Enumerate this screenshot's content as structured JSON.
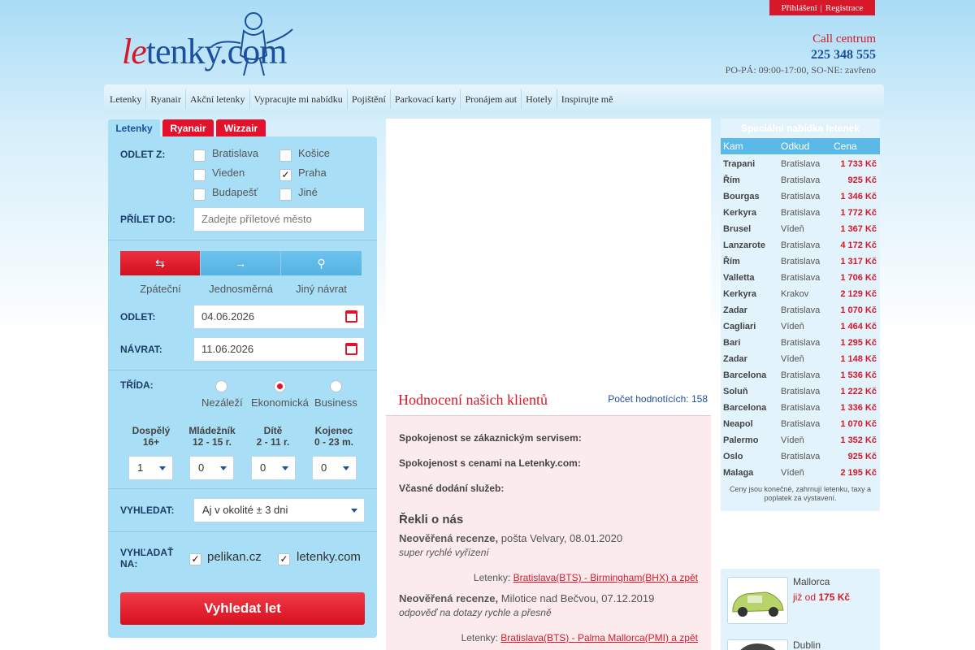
{
  "header": {
    "login": "Přihlášení",
    "divider": "|",
    "register": "Registrace",
    "logo_text_le": "le",
    "logo_text_rest": "tenky.com",
    "call_label": "Call centrum",
    "call_number": "225 348 555",
    "call_hours": "PO-PÁ: 09:00-17:00, SO-NE: zavřeno"
  },
  "nav": [
    "Letenky",
    "Ryanair",
    "Akční letenky",
    "Vypracujte mi nabídku",
    "Pojištění",
    "Parkovací karty",
    "Pronájem aut",
    "Hotely",
    "Inspirujte mě"
  ],
  "search": {
    "tabs": [
      "Letenky",
      "Ryanair",
      "Wizzair"
    ],
    "from_label": "ODLET Z:",
    "origins": [
      {
        "label": "Bratislava",
        "checked": false
      },
      {
        "label": "Košice",
        "checked": false
      },
      {
        "label": "Vieden",
        "checked": false
      },
      {
        "label": "Praha",
        "checked": true
      },
      {
        "label": "Budapešť",
        "checked": false
      },
      {
        "label": "Jiné",
        "checked": false
      }
    ],
    "to_label": "PŘÍLET DO:",
    "to_placeholder": "Zadejte příletové město",
    "trip_types": [
      "Zpáteční",
      "Jednosměrná",
      "Jiný návrat"
    ],
    "depart_label": "ODLET:",
    "depart_value": "04.06.2026",
    "return_label": "NÁVRAT:",
    "return_value": "11.06.2026",
    "class_label": "TŘÍDA:",
    "classes": [
      "Nezáleží",
      "Ekonomická",
      "Business"
    ],
    "class_selected": "Ekonomická",
    "pax": [
      {
        "title": "Dospělý",
        "sub": "16+",
        "value": "1"
      },
      {
        "title": "Mládežník",
        "sub": "12 - 15 r.",
        "value": "0"
      },
      {
        "title": "Dítě",
        "sub": "2 - 11 r.",
        "value": "0"
      },
      {
        "title": "Kojenec",
        "sub": "0 - 23 m.",
        "value": "0"
      }
    ],
    "flex_label": "VYHLEDAT:",
    "flex_value": "Aj v okolité ± 3 dni",
    "search_on_label_1": "VYHĽADAŤ",
    "search_on_label_2": "NA:",
    "search_on": [
      "pelikan.cz",
      "letenky.com"
    ],
    "submit": "Vyhledat let"
  },
  "reviews": {
    "title": "Hodnocení našich klientů",
    "count_label": "Počet hodnotících: 158",
    "criteria": [
      "Spokojenost se zákaznickým servisem:",
      "Spokojenost s cenami na Letenky.com:",
      "Včasné dodání služeb:"
    ],
    "said_title": "Řekli o nás",
    "items": [
      {
        "author": "Neověřená recenze,",
        "meta": " pošta Velvary, 08.01.2020",
        "text": "super rychlé vyřízení",
        "route_label": "Letenky: ",
        "route": "Bratislava(BTS) - Birmingham(BHX) a zpět"
      },
      {
        "author": "Neověřená recenze,",
        "meta": " Milotice nad Bečvou, 07.12.2019",
        "text": "odpověď na dotazy rychle a přesně",
        "route_label": "Letenky: ",
        "route": "Bratislava(BTS) - Palma Mallorca(PMI) a zpět"
      }
    ]
  },
  "offers": {
    "title": "Speciální nabídka letenek",
    "columns": [
      "Kam",
      "Odkud",
      "Cena"
    ],
    "rows": [
      [
        "Trapani",
        "Bratislava",
        "1 733 Kč"
      ],
      [
        "Řím",
        "Bratislava",
        "925 Kč"
      ],
      [
        "Bourgas",
        "Bratislava",
        "1 346 Kč"
      ],
      [
        "Kerkyra",
        "Bratislava",
        "1 772 Kč"
      ],
      [
        "Brusel",
        "Vídeň",
        "1 367 Kč"
      ],
      [
        "Lanzarote",
        "Bratislava",
        "4 172 Kč"
      ],
      [
        "Řím",
        "Bratislava",
        "1 317 Kč"
      ],
      [
        "Valletta",
        "Bratislava",
        "1 706 Kč"
      ],
      [
        "Kerkyra",
        "Krakov",
        "2 129 Kč"
      ],
      [
        "Zadar",
        "Bratislava",
        "1 070 Kč"
      ],
      [
        "Cagliari",
        "Vídeň",
        "1 464 Kč"
      ],
      [
        "Bari",
        "Bratislava",
        "1 295 Kč"
      ],
      [
        "Zadar",
        "Vídeň",
        "1 148 Kč"
      ],
      [
        "Barcelona",
        "Bratislava",
        "1 536 Kč"
      ],
      [
        "Soluň",
        "Bratislava",
        "1 222 Kč"
      ],
      [
        "Barcelona",
        "Bratislava",
        "1 336 Kč"
      ],
      [
        "Neapol",
        "Bratislava",
        "1 070 Kč"
      ],
      [
        "Palermo",
        "Vídeň",
        "1 352 Kč"
      ],
      [
        "Oslo",
        "Bratislava",
        "925 Kč"
      ],
      [
        "Malaga",
        "Vídeň",
        "2 195 Kč"
      ]
    ],
    "note": "Ceny jsou konečné, zahrnují letenku, taxy a poplatek za vystavení."
  },
  "cars": [
    {
      "city": "Mallorca",
      "price_prefix": "již od ",
      "price": "175 Kč"
    },
    {
      "city": "Dublin",
      "price_prefix": "",
      "price": ""
    }
  ],
  "colors": {
    "brand_red": "#d7182a",
    "brand_blue": "#1c4f9c",
    "panel": "#a8def6"
  }
}
